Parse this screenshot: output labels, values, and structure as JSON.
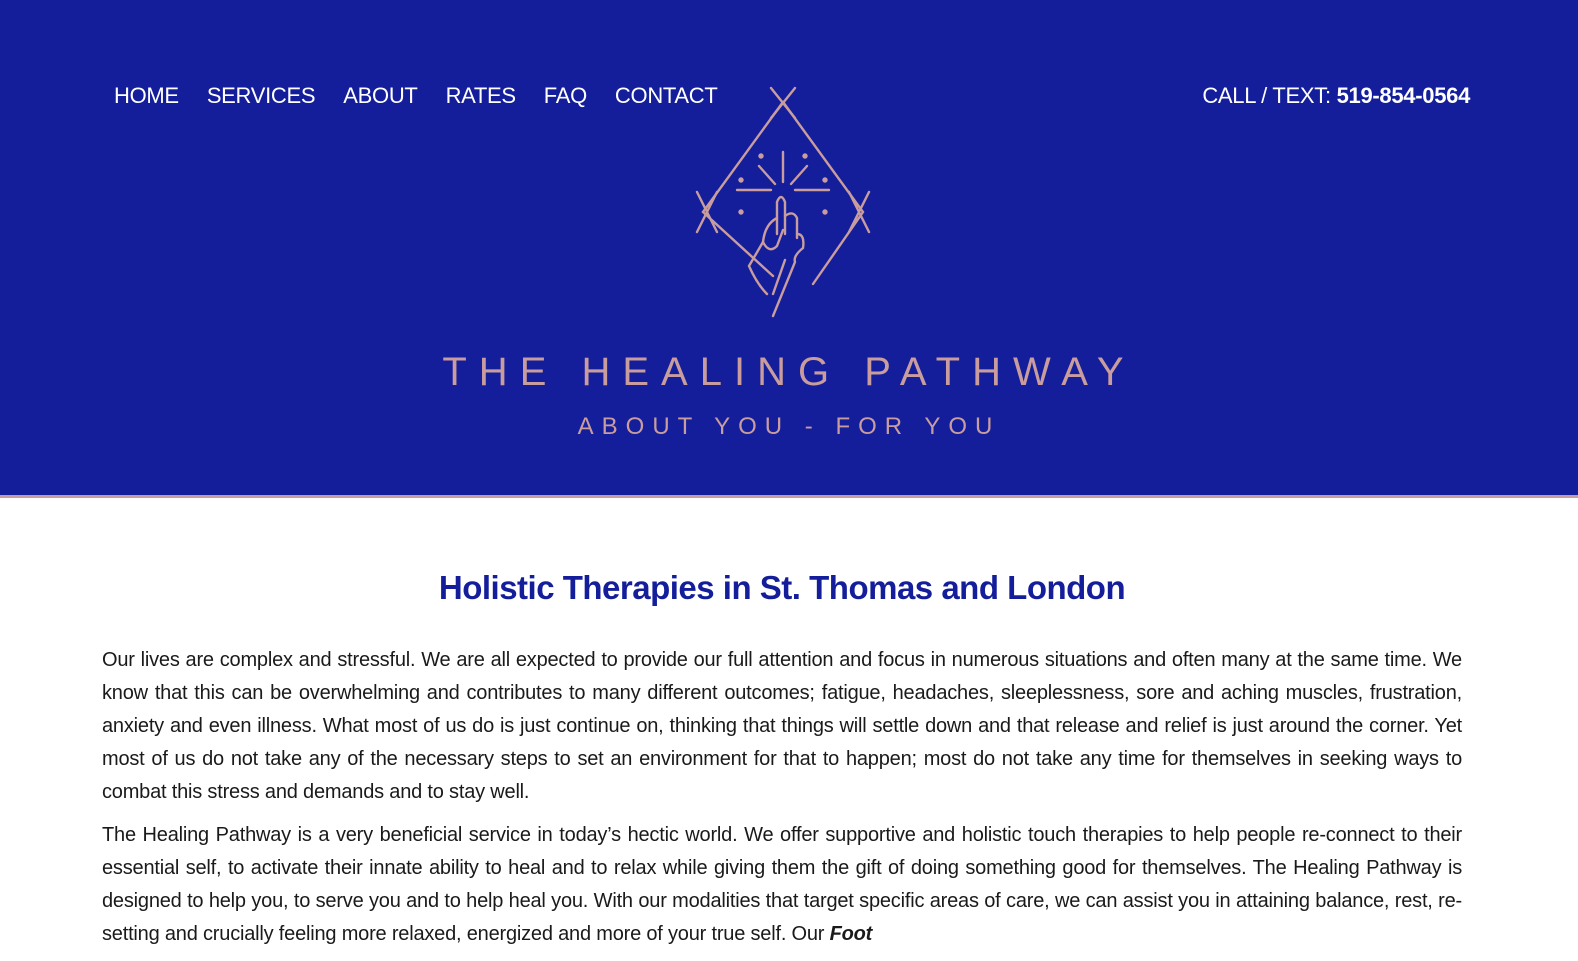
{
  "nav": {
    "items": [
      {
        "label": "HOME"
      },
      {
        "label": "SERVICES"
      },
      {
        "label": "ABOUT"
      },
      {
        "label": "RATES"
      },
      {
        "label": "FAQ"
      },
      {
        "label": "CONTACT"
      }
    ]
  },
  "header": {
    "call_label": "CALL / TEXT: ",
    "phone": "519-854-0564",
    "brand_name": "THE HEALING PATHWAY",
    "tagline": "ABOUT YOU - FOR YOU"
  },
  "main": {
    "heading": "Holistic Therapies in St. Thomas and London",
    "paragraph_1": "Our lives are complex and stressful. We are all expected to provide our full attention and focus in numerous situations and often many at the same time. We know that this can be overwhelming and contributes to many different outcomes; fatigue, headaches, sleeplessness, sore and aching muscles, frustration, anxiety and even illness. What most of us do is just continue on, thinking that things will settle down and that release and relief is just around the corner. Yet most of us do not take any of the necessary steps to set an environment for that to happen; most do not take any time for themselves in seeking ways to combat this stress and demands and to stay well.",
    "paragraph_2": "The Healing Pathway is a very beneficial service in today’s hectic world. We offer supportive and holistic touch therapies to help people re-connect to their essential self, to activate their innate ability to heal and to relax while giving them the gift of doing something good for themselves. The Healing Pathway is designed to help you, to serve you and to help heal you. With our modalities that target specific areas of care, we can assist you in attaining balance, rest, re-setting and crucially feeling more relaxed, energized and more of your true self. Our ",
    "paragraph_2_emphasis": "Foot"
  },
  "colors": {
    "brand_blue": "#141e9b",
    "accent_rose": "#c99c9e",
    "text": "#1a1a1a"
  },
  "icons": {
    "logo": "diamond-hand-sparkle-icon"
  }
}
